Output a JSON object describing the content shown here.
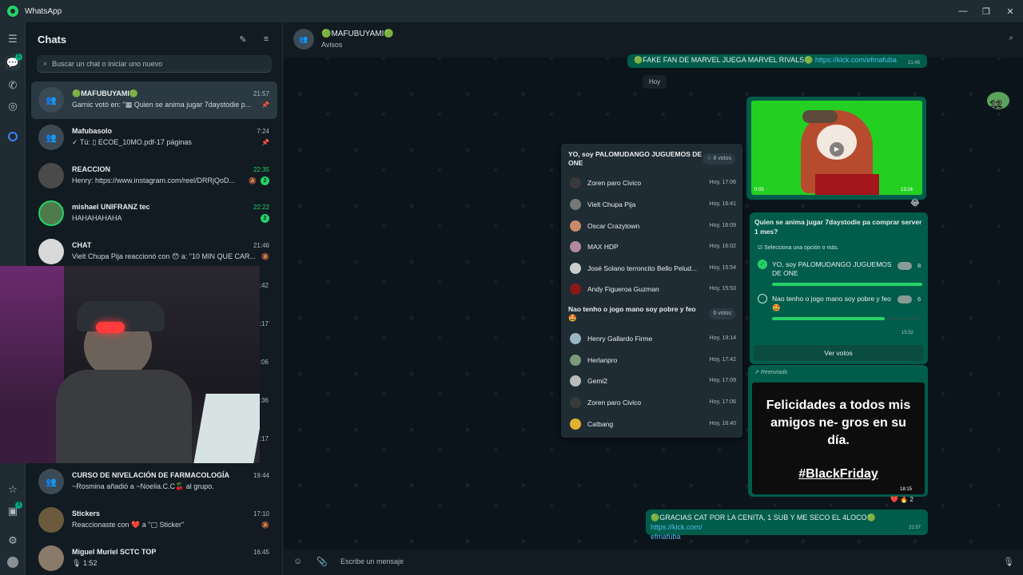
{
  "window": {
    "title": "WhatsApp",
    "min": "—",
    "max": "❐",
    "close": "✕"
  },
  "rail": {
    "chats_badge": "1",
    "status_badge": "3"
  },
  "sidebar": {
    "title": "Chats",
    "search_placeholder": "Buscar un chat o iniciar uno nuevo",
    "chats": [
      {
        "name": "🟢MAFUBUYAMI🟢",
        "preview": "Garnic votó en: \"▦ Quien se anima jugar 7daystodie p...",
        "time": "21:57"
      },
      {
        "name": "Mafubasolo",
        "preview": "✓ Tú: ▯ ECOE_10MO.pdf-17 páginas",
        "time": "7:24"
      },
      {
        "name": "REACCION",
        "preview": "Henry: https://www.instagram.com/reel/DRRjQoD...",
        "time": "22:35",
        "badge": "2"
      },
      {
        "name": "mishael UNIFRANZ tec",
        "preview": "HAHAHAHAHA",
        "time": "22:22",
        "badge": "2"
      },
      {
        "name": "CHAT",
        "preview": "Vielt Chupa Pija reaccionó con 😯 a: \"10 MIN QUE CAR...",
        "time": "21:46"
      },
      {
        "name": "CURSO DE NIVELACIÓN DE FARMACOLOGÍA",
        "preview": "~Rosmina añadió a ~Noelia.C.C🍒 al grupo.",
        "time": "19:44"
      },
      {
        "name": "Stickers",
        "preview": "Reaccionaste con ❤️ a \"▢ Sticker\"",
        "time": "17:10"
      },
      {
        "name": "Miguel Muriel SCTC TOP",
        "preview": "🎙 1:52",
        "time": "16:45"
      }
    ],
    "hidden_times": [
      "1:42",
      "1:17",
      "3:06",
      "3:36",
      "3:17"
    ]
  },
  "chat": {
    "title": "🟢MAFUBUYAMI🟢",
    "subtitle": "Avisos",
    "day_chip": "Hoy",
    "msg_top": {
      "text": "🟢FAKE FAN DE MARVEL JUEGA MARVEL RIVALS🟢",
      "link": "https://kick.com/efmafuba",
      "time": "21:45"
    },
    "video": {
      "duration": "0:05",
      "time": "13:24",
      "reaction": "😂"
    },
    "poll": {
      "question": "Quien se anima jugar 7daystodie pa comprar server 1 mes?",
      "hint": "Selecciona una opción o más.",
      "options": [
        {
          "text": "YO, soy PALOMUDANGO JUGUEMOS DE ONE",
          "count": "8",
          "fill": 1.0
        },
        {
          "text": "Nao tenho o jogo mano soy pobre y feo 🤩",
          "count": "6",
          "fill": 0.75
        }
      ],
      "time": "15:52",
      "view_votes": "Ver votos"
    },
    "forwarded": {
      "label": "Reenviado",
      "image_text": "Felicidades a todos mis amigos ne- gros en su día.",
      "hashtag": "#BlackFriday",
      "time": "18:15",
      "reactions": "❤️ 🔥",
      "reaction_count": "2"
    },
    "msg_bottom": {
      "text": "🟢GRACIAS CAT POR LA CENITA, 1 SUB Y ME SECO EL 4LOCO🟢",
      "link": "https://kick.com/",
      "link2": "efmafuba",
      "time": "21:57"
    },
    "composer_placeholder": "Escribe un mensaje",
    "sticker_number": "12"
  },
  "poll_panel": {
    "q1": "YO, soy PALOMUDANGO JUGUEMOS DE ONE",
    "q1_votes": "☆ 8 votos",
    "voters1": [
      {
        "name": "Zoren paro Civico",
        "time": "Hoy, 17:06"
      },
      {
        "name": "Vielt Chupa Pija",
        "time": "Hoy, 16:41"
      },
      {
        "name": "Oscar Crazytown",
        "time": "Hoy, 16:09"
      },
      {
        "name": "MAX HDP",
        "time": "Hoy, 16:02"
      },
      {
        "name": "José Solano terroncito Bello Pelud...",
        "time": "Hoy, 15:54"
      },
      {
        "name": "Andy Figueroa Guzman",
        "time": "Hoy, 15:53"
      }
    ],
    "q2": "Nao tenho o jogo mano soy pobre y feo 🤩",
    "q2_votes": "6 votos",
    "voters2": [
      {
        "name": "Henry Gallardo Firme",
        "time": "Hoy, 19:14"
      },
      {
        "name": "Herlanpro",
        "time": "Hoy, 17:42"
      },
      {
        "name": "Gemi2",
        "time": "Hoy, 17:09"
      },
      {
        "name": "Zoren paro Civico",
        "time": "Hoy, 17:06"
      },
      {
        "name": "Catbang",
        "time": "Hoy, 16:40"
      }
    ]
  },
  "colors": {
    "accent": "#25d366",
    "bubble_out": "#005c4b",
    "panel": "#1f2c33"
  }
}
